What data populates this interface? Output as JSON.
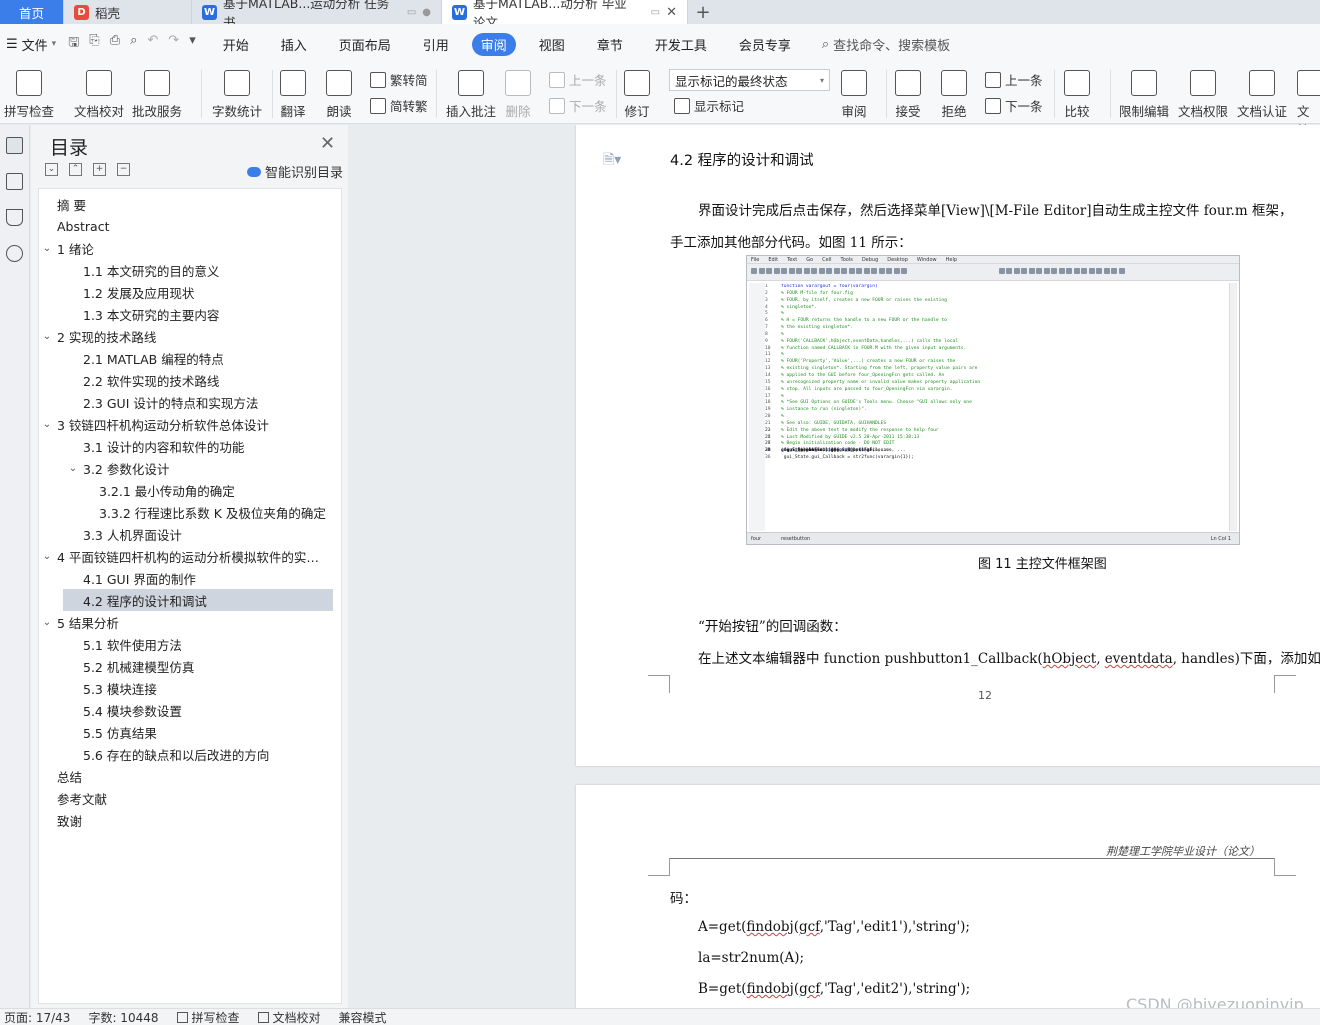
{
  "tabs": [
    {
      "label": "首页"
    },
    {
      "label": "稻壳"
    },
    {
      "label": "基于MATLAB...运动分析 任务书"
    },
    {
      "label": "基于MATLAB...动分析 毕业论文"
    }
  ],
  "menu": {
    "file": "文件",
    "items": [
      "开始",
      "插入",
      "页面布局",
      "引用",
      "审阅",
      "视图",
      "章节",
      "开发工具",
      "会员专享"
    ],
    "active": "审阅",
    "search": "查找命令、搜索模板"
  },
  "ribbon": {
    "spell_check": "拼写检查",
    "doc_proof": "文档校对",
    "review_service": "批改服务",
    "word_count": "字数统计",
    "translate": "翻译",
    "read_aloud": "朗读",
    "trad_to_simp": "繁转简",
    "simp_to_trad": "简转繁",
    "insert_comment": "插入批注",
    "delete": "删除",
    "prev_comment": "上一条",
    "next_comment": "下一条",
    "revise": "修订",
    "markup_select": "显示标记的最终状态",
    "show_markup": "显示标记",
    "review": "审阅",
    "accept": "接受",
    "reject": "拒绝",
    "prev_change": "上一条",
    "next_change": "下一条",
    "compare": "比较",
    "restrict_edit": "限制编辑",
    "doc_rights": "文档权限",
    "doc_cert": "文档认证",
    "doc_more": "文档"
  },
  "toc": {
    "title": "目录",
    "smart": "智能识别目录",
    "items": [
      {
        "text": "摘  要",
        "level": 1,
        "chev": false
      },
      {
        "text": "Abstract",
        "level": 1,
        "chev": false
      },
      {
        "text": "1  绪论",
        "level": 1,
        "chev": true
      },
      {
        "text": "1.1  本文研究的目的意义",
        "level": 2,
        "chev": false
      },
      {
        "text": "1.2  发展及应用现状",
        "level": 2,
        "chev": false
      },
      {
        "text": "1.3  本文研究的主要内容",
        "level": 2,
        "chev": false
      },
      {
        "text": "2  实现的技术路线",
        "level": 1,
        "chev": true
      },
      {
        "text": "2.1 MATLAB 编程的特点",
        "level": 2,
        "chev": false
      },
      {
        "text": "2.2  软件实现的技术路线",
        "level": 2,
        "chev": false
      },
      {
        "text": "2.3 GUI 设计的特点和实现方法",
        "level": 2,
        "chev": false
      },
      {
        "text": "3  铰链四杆机构运动分析软件总体设计",
        "level": 1,
        "chev": true
      },
      {
        "text": "3.1  设计的内容和软件的功能",
        "level": 2,
        "chev": false
      },
      {
        "text": "3.2  参数化设计",
        "level": 2,
        "chev": true
      },
      {
        "text": "3.2.1  最小传动角的确定",
        "level": 3,
        "chev": false
      },
      {
        "text": "3.3.2  行程速比系数 K 及极位夹角的确定",
        "level": 3,
        "chev": false
      },
      {
        "text": "3.3  人机界面设计",
        "level": 2,
        "chev": false
      },
      {
        "text": "4  平面铰链四杆机构的运动分析模拟软件的实…",
        "level": 1,
        "chev": true
      },
      {
        "text": "4.1 GUI 界面的制作",
        "level": 2,
        "chev": false
      },
      {
        "text": "4.2  程序的设计和调试",
        "level": 2,
        "chev": false,
        "selected": true
      },
      {
        "text": "5  结果分析",
        "level": 1,
        "chev": true
      },
      {
        "text": "5.1 软件使用方法",
        "level": 2,
        "chev": false
      },
      {
        "text": "5.2  机械建模型仿真",
        "level": 2,
        "chev": false
      },
      {
        "text": "5.3  模块连接",
        "level": 2,
        "chev": false
      },
      {
        "text": "5.4  模块参数设置",
        "level": 2,
        "chev": false
      },
      {
        "text": "5.5  仿真结果",
        "level": 2,
        "chev": false
      },
      {
        "text": "5.6  存在的缺点和以后改进的方向",
        "level": 2,
        "chev": false
      },
      {
        "text": "总结",
        "level": 1,
        "chev": false
      },
      {
        "text": "参考文献",
        "level": 1,
        "chev": false
      },
      {
        "text": "致谢",
        "level": 1,
        "chev": false
      }
    ]
  },
  "doc": {
    "heading": "4.2  程序的设计和调试",
    "para1_line1": "界面设计完成后点击保存，然后选择菜单[View]\\[M-File Editor]自动生成主控文件 four.m 框架，",
    "para1_line2": "手工添加其他部分代码。如图 11 所示：",
    "figure_caption": "图 11 主控文件框架图",
    "para2": "“开始按钮”的回调函数：",
    "para3_a": "在上述文本编辑器中 function pushbutton1_Callback(",
    "para3_w1": "hObject",
    "para3_b": ", ",
    "para3_w2": "eventdata",
    "para3_c": ", handles)下面，添加如下代",
    "page_number": "12",
    "page2_header": "荆楚理工学院毕业设计（论文）",
    "page2_line1": "码：",
    "code1_a": "A=get(",
    "code1_w1": "findobj",
    "code1_b": "(",
    "code1_w2": "gcf",
    "code1_c": ",'Tag','edit1'),'string');",
    "code2": "la=str2num(A);",
    "code3_a": "B=get(",
    "code3_w1": "findobj",
    "code3_b": "(",
    "code3_w2": "gcf",
    "code3_c": ",'Tag','edit2'),'string');"
  },
  "figure": {
    "menu": [
      "File",
      "Edit",
      "Text",
      "Go",
      "Cell",
      "Tools",
      "Debug",
      "Desktop",
      "Window",
      "Help"
    ],
    "status_left": "four",
    "status_mid": "resetbutton",
    "status_right": "Ln  Col 1",
    "lines": [
      {
        "n": "1",
        "t": "function varargout = four(varargin)",
        "type": "k"
      },
      {
        "n": "2",
        "t": "% FOUR M-file for four.fig",
        "type": "c"
      },
      {
        "n": "3",
        "t": "%      FOUR, by itself, creates a new FOUR or raises the existing",
        "type": "c"
      },
      {
        "n": "4",
        "t": "%      singleton*.",
        "type": "c"
      },
      {
        "n": "5",
        "t": "%",
        "type": "c"
      },
      {
        "n": "6",
        "t": "%      H = FOUR returns the handle to a new FOUR or the handle to",
        "type": "c"
      },
      {
        "n": "7",
        "t": "%      the existing singleton*.",
        "type": "c"
      },
      {
        "n": "8",
        "t": "%",
        "type": "c"
      },
      {
        "n": "9",
        "t": "%      FOUR('CALLBACK',hObject,eventData,handles,...) calls the local",
        "type": "c"
      },
      {
        "n": "10",
        "t": "%      function named CALLBACK in FOUR.M with the given input arguments.",
        "type": "c"
      },
      {
        "n": "11",
        "t": "%",
        "type": "c"
      },
      {
        "n": "12",
        "t": "%      FOUR('Property','Value',...) creates a new FOUR or raises the",
        "type": "c"
      },
      {
        "n": "13",
        "t": "%      existing singleton*.  Starting from the left, property value pairs are",
        "type": "c"
      },
      {
        "n": "14",
        "t": "%      applied to the GUI before four_OpeningFcn gets called.  An",
        "type": "c"
      },
      {
        "n": "15",
        "t": "%      unrecognized property name or invalid value makes property application",
        "type": "c"
      },
      {
        "n": "16",
        "t": "%      stop.  All inputs are passed to four_OpeningFcn via varargin.",
        "type": "c"
      },
      {
        "n": "17",
        "t": "%",
        "type": "c"
      },
      {
        "n": "18",
        "t": "%      *See GUI Options on GUIDE's Tools menu.  Choose \"GUI allows only one",
        "type": "c"
      },
      {
        "n": "19",
        "t": "%      instance to run (singleton)\".",
        "type": "c"
      },
      {
        "n": "20",
        "t": "%",
        "type": "c"
      },
      {
        "n": "21",
        "t": "% See also: GUIDE, GUIDATA, GUIHANDLES",
        "type": "c"
      },
      {
        "n": "22",
        "t": "",
        "type": "p"
      },
      {
        "n": "23",
        "t": "% Edit the above text to modify the response to help four",
        "type": "c"
      },
      {
        "n": "24",
        "t": "",
        "type": "p"
      },
      {
        "n": "25",
        "t": "% Last Modified by GUIDE v2.5 28-Apr-2011 15:38:13",
        "type": "c"
      },
      {
        "n": "26",
        "t": "",
        "type": "p"
      },
      {
        "n": "27",
        "t": "% Begin initialization code - DO NOT EDIT",
        "type": "c"
      },
      {
        "n": "28",
        "t": "gui_Singleton = 1;",
        "type": "p"
      },
      {
        "n": "29",
        "t": "gui_State = struct('gui_Name',       mfilename, ...",
        "type": "p"
      },
      {
        "n": "30",
        "t": "                   'gui_Singleton',  gui_Singleton, ...",
        "type": "p"
      },
      {
        "n": "31",
        "t": "                   'gui_OpeningFcn', @four_OpeningFcn, ...",
        "type": "p"
      },
      {
        "n": "32",
        "t": "                   'gui_OutputFcn',  @four_OutputFcn, ...",
        "type": "p"
      },
      {
        "n": "33",
        "t": "                   'gui_LayoutFcn',  [] , ...",
        "type": "p"
      },
      {
        "n": "34",
        "t": "                   'gui_Callback',   []);",
        "type": "p"
      },
      {
        "n": "35",
        "t": "if nargin && ischar(varargin{1})",
        "type": "k"
      },
      {
        "n": "36",
        "t": "    gui_State.gui_Callback = str2func(varargin{1});",
        "type": "p"
      }
    ]
  },
  "status": {
    "page": "页面: 17/43",
    "words": "字数: 10448",
    "spell": "拼写检查",
    "proof": "文档校对",
    "compat": "兼容模式"
  },
  "watermark": "CSDN @biyezuopinvip",
  "colors": {
    "accent": "#3b7de9"
  }
}
